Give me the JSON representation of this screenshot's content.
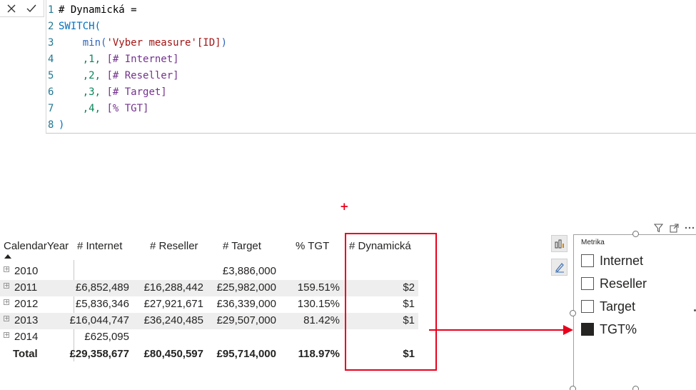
{
  "formula_bar": {
    "lines": [
      {
        "n": "1",
        "tokens": [
          {
            "t": "# Dynamická =",
            "c": "plain"
          }
        ]
      },
      {
        "n": "2",
        "tokens": [
          {
            "t": "SWITCH(",
            "c": "kw"
          }
        ]
      },
      {
        "n": "3",
        "tokens": [
          {
            "t": "    min(",
            "c": "fn"
          },
          {
            "t": "'Vyber measure'[ID]",
            "c": "str"
          },
          {
            "t": ")",
            "c": "fn"
          }
        ]
      },
      {
        "n": "4",
        "tokens": [
          {
            "t": "    ,1, ",
            "c": "num"
          },
          {
            "t": "[# Internet]",
            "c": "meas"
          }
        ]
      },
      {
        "n": "5",
        "tokens": [
          {
            "t": "    ,2, ",
            "c": "num"
          },
          {
            "t": "[# Reseller]",
            "c": "meas"
          }
        ]
      },
      {
        "n": "6",
        "tokens": [
          {
            "t": "    ,3, ",
            "c": "num"
          },
          {
            "t": "[# Target]",
            "c": "meas"
          }
        ]
      },
      {
        "n": "7",
        "tokens": [
          {
            "t": "    ,4, ",
            "c": "num"
          },
          {
            "t": "[% TGT]",
            "c": "meas"
          }
        ]
      },
      {
        "n": "8",
        "tokens": [
          {
            "t": ")",
            "c": "kw"
          }
        ]
      }
    ]
  },
  "table": {
    "headers": [
      "CalendarYear",
      "# Internet",
      "# Reseller",
      "# Target",
      "% TGT",
      "# Dynamická"
    ],
    "rows": [
      {
        "year": "2010",
        "internet": "",
        "reseller": "",
        "target": "£3,886,000",
        "tgt": "",
        "dyn": ""
      },
      {
        "year": "2011",
        "internet": "£6,852,489",
        "reseller": "£16,288,442",
        "target": "£25,982,000",
        "tgt": "159.51%",
        "dyn": "$2"
      },
      {
        "year": "2012",
        "internet": "£5,836,346",
        "reseller": "£27,921,671",
        "target": "£36,339,000",
        "tgt": "130.15%",
        "dyn": "$1"
      },
      {
        "year": "2013",
        "internet": "£16,044,747",
        "reseller": "£36,240,485",
        "target": "£29,507,000",
        "tgt": "81.42%",
        "dyn": "$1"
      },
      {
        "year": "2014",
        "internet": "£625,095",
        "reseller": "",
        "target": "",
        "tgt": "",
        "dyn": ""
      }
    ],
    "total": {
      "year": "Total",
      "internet": "£29,358,677",
      "reseller": "£80,450,597",
      "target": "£95,714,000",
      "tgt": "118.97%",
      "dyn": "$1"
    },
    "expand_glyph": "+"
  },
  "slicer": {
    "title": "Metrika",
    "items": [
      {
        "label": "Internet",
        "checked": false
      },
      {
        "label": "Reseller",
        "checked": false
      },
      {
        "label": "Target",
        "checked": false
      },
      {
        "label": "TGT%",
        "checked": true
      }
    ]
  },
  "colors": {
    "highlight": "#e8001c",
    "band": "#eeeeee"
  }
}
